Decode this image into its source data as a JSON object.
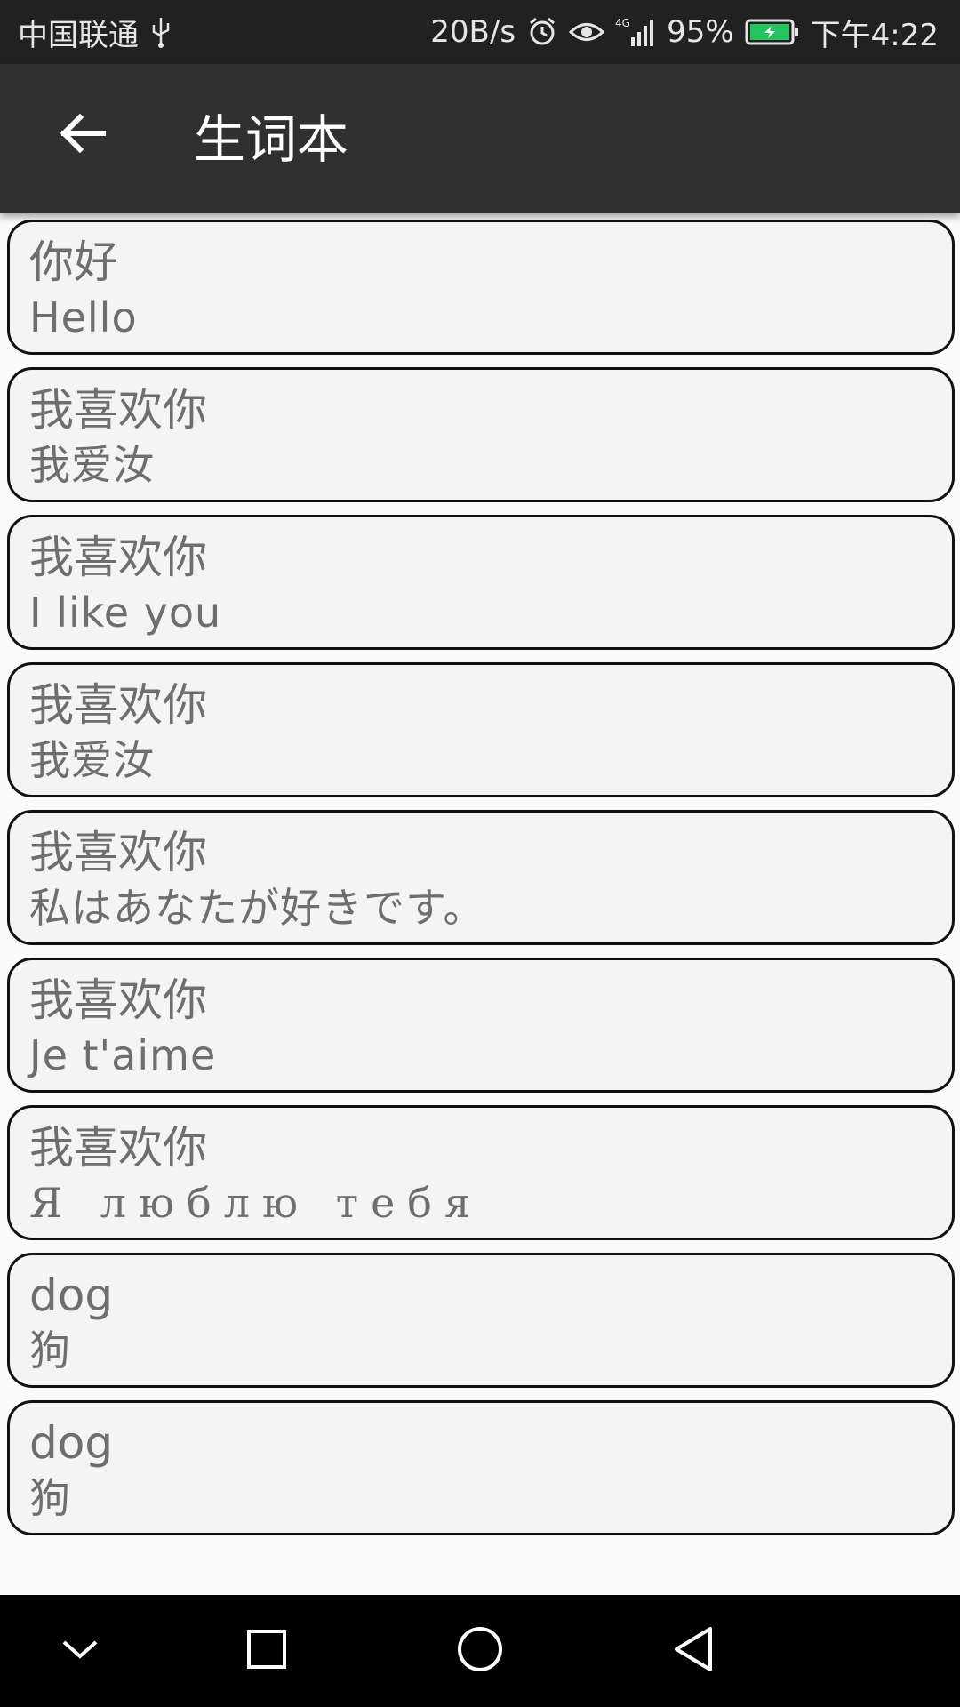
{
  "status_bar": {
    "carrier": "中国联通",
    "net_speed": "20B/s",
    "battery_percent": "95%",
    "time": "下午4:22",
    "icons": [
      "usb-icon",
      "alarm-icon",
      "eye-icon",
      "signal-4g-icon",
      "battery-charging-icon"
    ],
    "battery_color": "#22c55e"
  },
  "app_bar": {
    "title": "生词本",
    "back_icon": "arrow-left-icon"
  },
  "entries": [
    {
      "word": "你好",
      "meaning": "Hello"
    },
    {
      "word": "我喜欢你",
      "meaning": "我爱汝"
    },
    {
      "word": "我喜欢你",
      "meaning": "I like you"
    },
    {
      "word": "我喜欢你",
      "meaning": "我爱汝"
    },
    {
      "word": "我喜欢你",
      "meaning": "私はあなたが好きです。"
    },
    {
      "word": "我喜欢你",
      "meaning": "Je t'aime"
    },
    {
      "word": "我喜欢你",
      "meaning": "Я люблю тебя"
    },
    {
      "word": "dog",
      "meaning": "狗"
    },
    {
      "word": "dog",
      "meaning": "狗"
    }
  ],
  "nav_bar": {
    "icons": [
      "chevron-down-icon",
      "square-recents-icon",
      "circle-home-icon",
      "triangle-back-icon"
    ]
  }
}
